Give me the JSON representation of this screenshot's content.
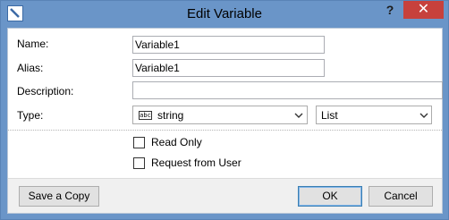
{
  "window": {
    "title": "Edit Variable",
    "help_label": "?",
    "close_label": "✕"
  },
  "form": {
    "name_label": "Name:",
    "name_value": "Variable1",
    "alias_label": "Alias:",
    "alias_value": "Variable1",
    "description_label": "Description:",
    "description_value": "",
    "type_label": "Type:",
    "type_icon_text": "abc",
    "type_value": "string",
    "collection_value": "List"
  },
  "options": {
    "read_only_label": "Read Only",
    "read_only_checked": false,
    "request_label": "Request from User",
    "request_checked": false
  },
  "buttons": {
    "save_copy": "Save a Copy",
    "ok": "OK",
    "cancel": "Cancel"
  },
  "icons": {
    "app": "edit-pencil-icon",
    "dropdown": "chevron-down-icon"
  }
}
